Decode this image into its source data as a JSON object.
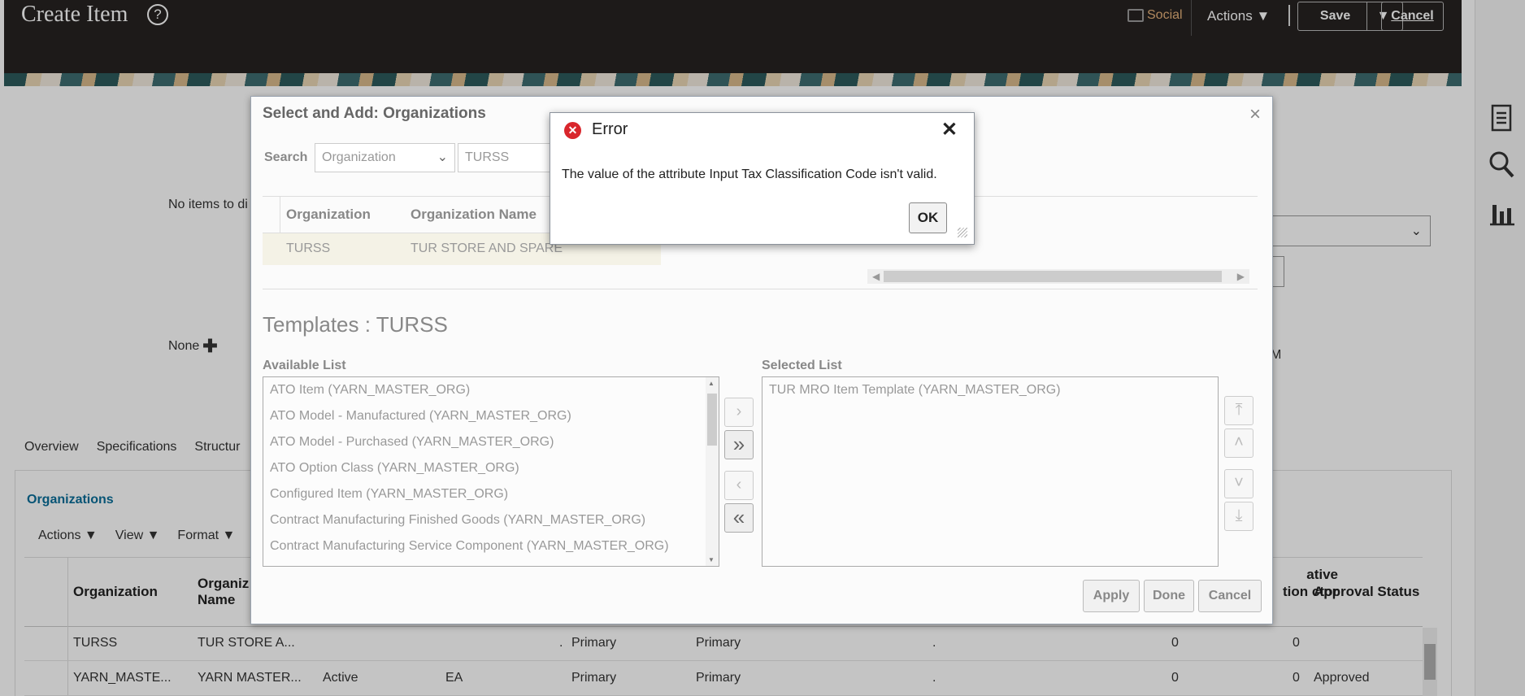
{
  "header": {
    "title": "Create Item",
    "help_icon": "?",
    "social": "Social",
    "actions": "Actions ▼",
    "save": "Save",
    "save_caret": "▼",
    "cancel": "Cancel"
  },
  "background": {
    "no_items": "No items to di",
    "none": "None",
    "m_text": "M",
    "tabs": [
      "Overview",
      "Specifications",
      "Structur"
    ],
    "section_title": "Organizations",
    "toolbar": [
      "Actions ▼",
      "View ▼",
      "Format ▼"
    ],
    "columns": [
      "Organization",
      "Organiz Name",
      "ative tion ctor",
      "Approval Status"
    ],
    "rows": [
      {
        "org": "TURSS",
        "name": "TUR STORE A...",
        "status": "",
        "uom": "",
        "dot1": ".",
        "c1": "Primary",
        "c2": "Primary",
        "dot2": ".",
        "n1": "0",
        "n2": "0",
        "approval": ""
      },
      {
        "org": "YARN_MASTE...",
        "name": "YARN MASTER...",
        "status": "Active",
        "uom": "EA",
        "dot1": "",
        "c1": "Primary",
        "c2": "Primary",
        "dot2": ".",
        "n1": "0",
        "n2": "0",
        "approval": "Approved"
      }
    ]
  },
  "dialog": {
    "title": "Select and Add: Organizations",
    "search_label": "Search",
    "search_type": "Organization",
    "search_value": "TURSS",
    "result_columns": [
      "Organization",
      "Organization Name"
    ],
    "result_row": {
      "org": "TURSS",
      "name": "TUR STORE AND SPARE"
    },
    "templates_title": "Templates : TURSS",
    "available_label": "Available List",
    "selected_label": "Selected List",
    "available_items": [
      "ATO Item (YARN_MASTER_ORG)",
      "ATO Model - Manufactured (YARN_MASTER_ORG)",
      "ATO Model - Purchased (YARN_MASTER_ORG)",
      "ATO Option Class (YARN_MASTER_ORG)",
      "Configured Item (YARN_MASTER_ORG)",
      "Contract Manufacturing Finished Goods (YARN_MASTER_ORG)",
      "Contract Manufacturing Service Component (YARN_MASTER_ORG)"
    ],
    "selected_items": [
      "TUR MRO Item Template (YARN_MASTER_ORG)"
    ],
    "buttons": {
      "apply": "Apply",
      "done": "Done",
      "cancel": "Cancel"
    }
  },
  "error": {
    "title": "Error",
    "message": "The value of the attribute Input Tax Classification Code isn't valid.",
    "ok": "OK"
  },
  "icons": [
    "help-icon",
    "chat-icon",
    "document-icon",
    "search-icon",
    "chart-icon",
    "close-icon",
    "error-icon",
    "plus-icon"
  ]
}
